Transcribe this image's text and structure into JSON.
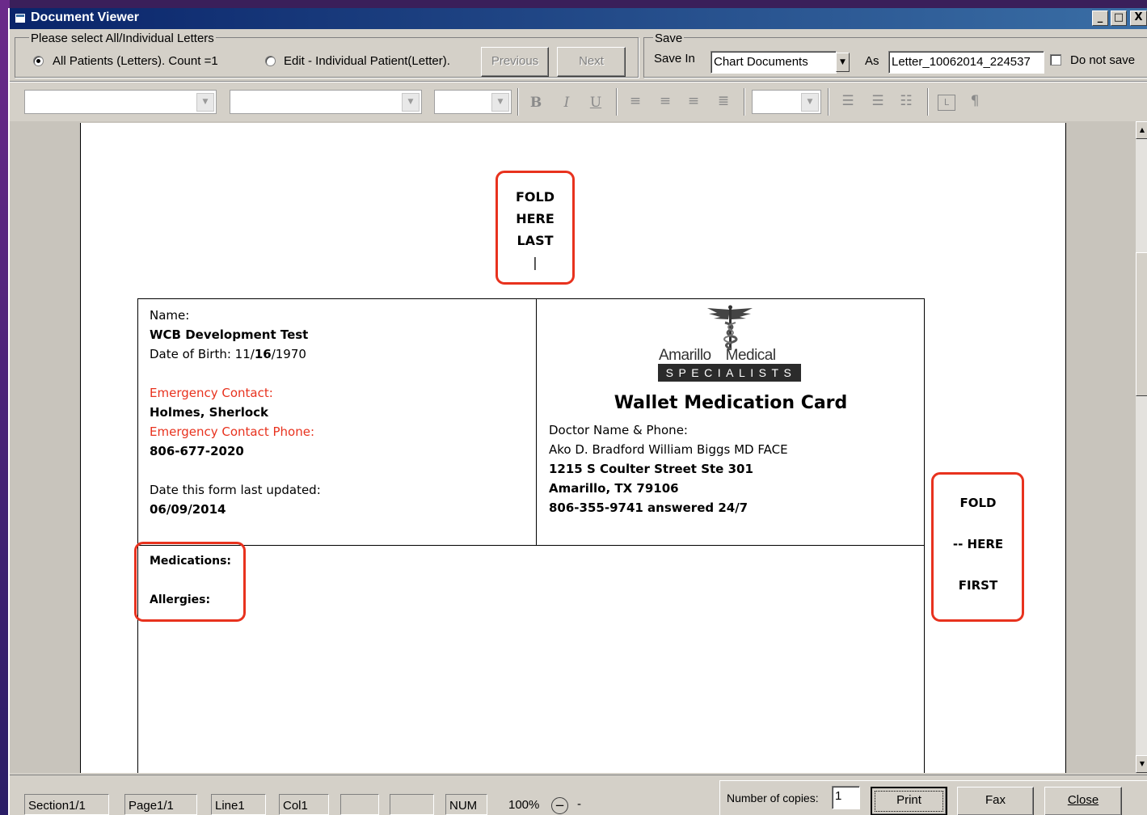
{
  "window": {
    "title": "Document Viewer",
    "controls": [
      "_",
      "□",
      "X"
    ]
  },
  "select_group": {
    "label": "Please select All/Individual Letters",
    "all_option": "All Patients (Letters). Count =1",
    "edit_option": "Edit -  Individual Patient(Letter).",
    "previous_button": "Previous",
    "next_button": "Next"
  },
  "save_group": {
    "label": "Save",
    "save_in_label": "Save In",
    "save_in_value": "Chart Documents",
    "as_label": "As",
    "filename": "Letter_10062014_224537",
    "do_not_save_label": "Do not save"
  },
  "toolbar": {
    "bold": "B",
    "italic": "I",
    "underline": "U",
    "pilcrow": "¶"
  },
  "document": {
    "fold_last": {
      "line1": "FOLD",
      "line2": "HERE",
      "line3": "LAST",
      "marker": "|"
    },
    "fold_first": {
      "line1": "FOLD",
      "line2": "-- HERE",
      "line3": "FIRST"
    },
    "patient": {
      "name_label": "Name:",
      "name": "WCB Development Test",
      "dob_prefix": "Date of Birth: 11/",
      "dob_bold": "16",
      "dob_suffix": "/1970",
      "emergency_contact_label": "Emergency Contact:",
      "emergency_contact": "Holmes, Sherlock",
      "emergency_phone_label": "Emergency Contact Phone:",
      "emergency_phone": "806-677-2020",
      "updated_label": "Date this form last updated:",
      "updated": "06/09/2014"
    },
    "clinic": {
      "logo_name_left": "Amarillo",
      "logo_name_right": "Medical",
      "logo_band": "SPECIALISTS",
      "card_title": "Wallet Medication Card",
      "doctor_label": "Doctor Name & Phone:",
      "doctor": "Ako D. Bradford William Biggs MD FACE",
      "street": "1215 S Coulter Street Ste 301",
      "city": "Amarillo, TX 79106",
      "phone": "806-355-9741  answered 24/7"
    },
    "medications_label": "Medications:",
    "allergies_label": "Allergies:"
  },
  "statusbar": {
    "section": "Section1/1",
    "page": "Page1/1",
    "line": "Line1",
    "col": "Col1",
    "num": "NUM",
    "zoom": "100%",
    "zoom_suffix": "-"
  },
  "print_panel": {
    "copies_label": "Number of copies:",
    "copies_value": "1",
    "print_button": "Print",
    "fax_button": "Fax",
    "close_button": "Close"
  },
  "colors": {
    "title_bar": "#0a246a",
    "annotation_red": "#e8321e",
    "window_face": "#d4d0c8"
  }
}
